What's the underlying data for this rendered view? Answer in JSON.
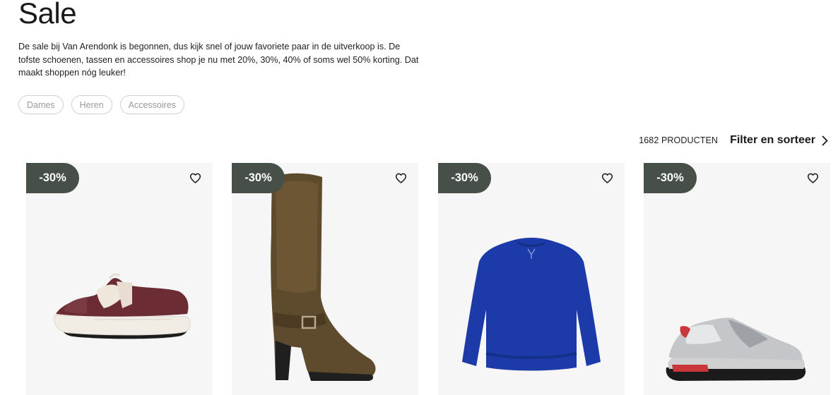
{
  "page": {
    "title": "Sale",
    "intro": "De sale bij Van Arendonk is begonnen, dus kijk snel of jouw favoriete paar in de uitverkoop is. De tofste schoenen, tassen en accessoires shop je nu met 20%, 30%, 40% of soms wel 50% korting. Dat maakt shoppen nóg leuker!"
  },
  "chips": [
    "Dames",
    "Heren",
    "Accessoires"
  ],
  "toolbar": {
    "count": "1682 PRODUCTEN",
    "filter_label": "Filter en sorteer"
  },
  "products": [
    {
      "badge": "-30%",
      "image": "sneaker-burgundy"
    },
    {
      "badge": "-30%",
      "image": "knee-boot-brown-suede"
    },
    {
      "badge": "-30%",
      "image": "sweater-cobalt-blue"
    },
    {
      "badge": "-30%",
      "image": "running-sneaker-silver"
    }
  ],
  "colors": {
    "badge_bg": "#475048",
    "card_bg": "#f6f6f6",
    "chip_border": "#cfcfcf",
    "chip_text": "#9a9a9a"
  },
  "icons": {
    "wishlist": "heart-outline-icon",
    "filter_arrow": "chevron-right-icon"
  }
}
